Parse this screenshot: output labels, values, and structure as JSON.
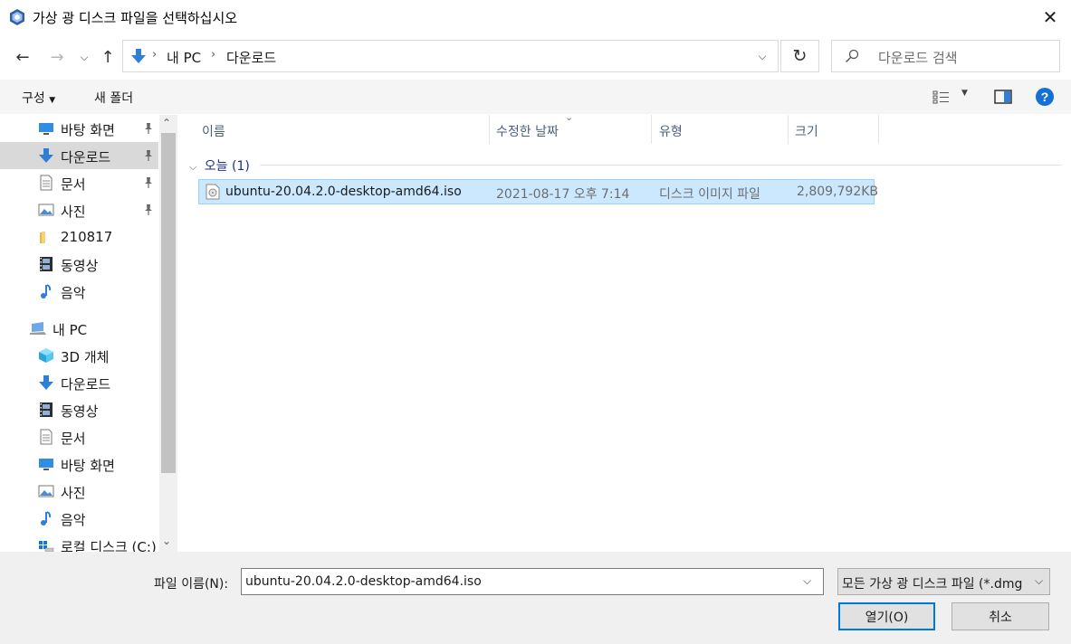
{
  "window": {
    "title": "가상 광 디스크 파일을 선택하십시오"
  },
  "address": {
    "crumbs": [
      "내 PC",
      "다운로드"
    ]
  },
  "search": {
    "placeholder": "다운로드 검색"
  },
  "toolbar": {
    "organize": "구성",
    "new_folder": "새 폴더"
  },
  "sidebar": {
    "quick": [
      {
        "label": "바탕 화면",
        "icon": "desktop-icon",
        "pinned": true
      },
      {
        "label": "다운로드",
        "icon": "download-icon",
        "pinned": true,
        "selected": true
      },
      {
        "label": "문서",
        "icon": "document-icon",
        "pinned": true
      },
      {
        "label": "사진",
        "icon": "picture-icon",
        "pinned": true
      },
      {
        "label": "210817",
        "icon": "folder-icon"
      },
      {
        "label": "동영상",
        "icon": "video-icon"
      },
      {
        "label": "음악",
        "icon": "music-icon"
      }
    ],
    "pc": {
      "label": "내 PC",
      "icon": "computer-icon"
    },
    "pc_items": [
      {
        "label": "3D 개체",
        "icon": "3d-objects-icon"
      },
      {
        "label": "다운로드",
        "icon": "download-icon"
      },
      {
        "label": "동영상",
        "icon": "video-icon"
      },
      {
        "label": "문서",
        "icon": "document-icon"
      },
      {
        "label": "바탕 화면",
        "icon": "desktop-icon"
      },
      {
        "label": "사진",
        "icon": "picture-icon"
      },
      {
        "label": "음악",
        "icon": "music-icon"
      },
      {
        "label": "로컬 디스크 (C:)",
        "icon": "local-disk-icon"
      }
    ]
  },
  "columns": {
    "name": "이름",
    "date": "수정한 날짜",
    "type": "유형",
    "size": "크기"
  },
  "group": {
    "label": "오늘 (1)"
  },
  "files": [
    {
      "name": "ubuntu-20.04.2.0-desktop-amd64.iso",
      "date": "2021-08-17 오후 7:14",
      "type": "디스크 이미지 파일",
      "size": "2,809,792KB"
    }
  ],
  "bottom": {
    "filename_label": "파일 이름(N):",
    "filename_value": "ubuntu-20.04.2.0-desktop-amd64.iso",
    "filter_value": "모든 가상 광 디스크 파일 (*.dmg",
    "open": "열기(O)",
    "cancel": "취소"
  }
}
